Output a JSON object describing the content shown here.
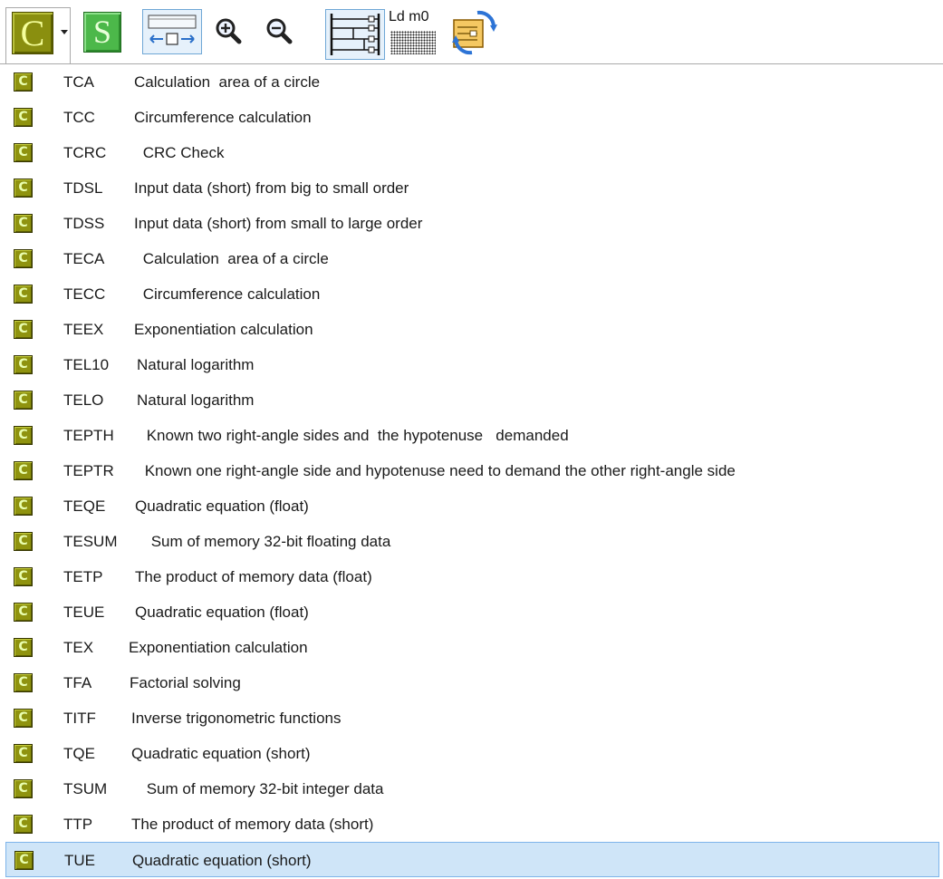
{
  "toolbar": {
    "c_button": "C",
    "s_button": "S",
    "ld_label": "Ld m0",
    "icons": [
      "c-program-icon",
      "dropdown-arrow-icon",
      "s-program-icon",
      "fit-width-icon",
      "zoom-in-icon",
      "zoom-out-icon",
      "ladder-view-icon",
      "instruction-list-icon",
      "convert-icon"
    ]
  },
  "list": {
    "icon_glyph": "C",
    "items": [
      {
        "name": "TCA",
        "desc": "Calculation  area of a circle"
      },
      {
        "name": "TCC",
        "desc": "Circumference calculation"
      },
      {
        "name": "TCRC",
        "desc": " CRC Check"
      },
      {
        "name": "TDSL",
        "desc": "Input data (short) from big to small order"
      },
      {
        "name": "TDSS",
        "desc": "Input data (short) from small to large order"
      },
      {
        "name": "TECA",
        "desc": " Calculation  area of a circle"
      },
      {
        "name": "TECC",
        "desc": " Circumference calculation"
      },
      {
        "name": "TEEX",
        "desc": "Exponentiation calculation"
      },
      {
        "name": "TEL10",
        "desc": "Natural logarithm"
      },
      {
        "name": "TELO",
        "desc": "Natural logarithm"
      },
      {
        "name": "TEPTH",
        "desc": " Known two right-angle sides and  the hypotenuse   demanded"
      },
      {
        "name": "TEPTR",
        "desc": " Known one right-angle side and hypotenuse need to demand the other right-angle side"
      },
      {
        "name": "TEQE",
        "desc": "Quadratic equation (float)"
      },
      {
        "name": "TESUM",
        "desc": " Sum of memory 32-bit floating data"
      },
      {
        "name": "TETP",
        "desc": "The product of memory data (float)"
      },
      {
        "name": "TEUE",
        "desc": "Quadratic equation (float)"
      },
      {
        "name": "TEX",
        "desc": "Exponentiation calculation"
      },
      {
        "name": "TFA",
        "desc": "Factorial solving"
      },
      {
        "name": "TITF",
        "desc": "Inverse trigonometric functions"
      },
      {
        "name": "TQE",
        "desc": "Quadratic equation (short)"
      },
      {
        "name": "TSUM",
        "desc": " Sum of memory 32-bit integer data"
      },
      {
        "name": "TTP",
        "desc": "The product of memory data (short)"
      },
      {
        "name": "TUE",
        "desc": "Quadratic equation (short)"
      }
    ],
    "selected_name": "TUE"
  }
}
